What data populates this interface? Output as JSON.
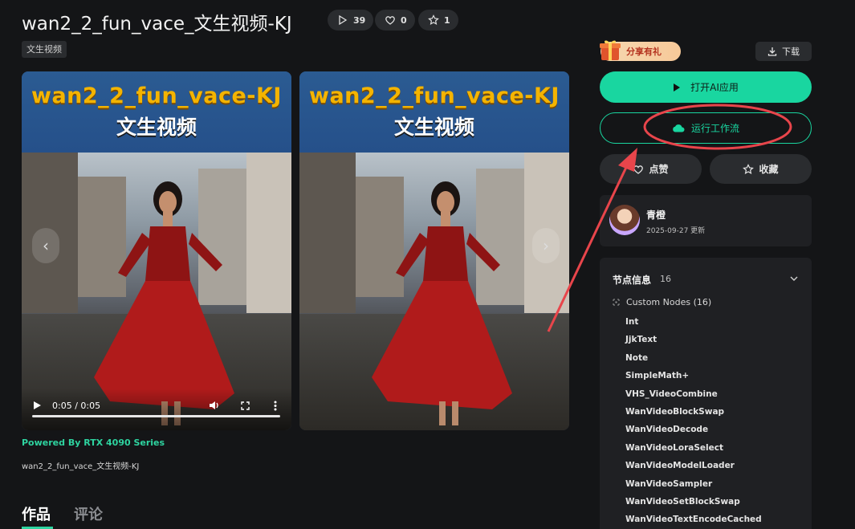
{
  "header": {
    "title": "wan2_2_fun_vace_文生视频-KJ",
    "plays": "39",
    "likes": "0",
    "favorites": "1",
    "tag": "文生视频"
  },
  "media": {
    "banner_title": "wan2_2_fun_vace-KJ",
    "banner_subtitle": "文生视频",
    "time": "0:05 / 0:05",
    "progress_fraction": 1.0,
    "powered_by": "Powered By RTX 4090 Series",
    "filename": "wan2_2_fun_vace_文生视频-KJ"
  },
  "tabs": [
    {
      "label": "作品"
    },
    {
      "label": "评论"
    }
  ],
  "sidebar": {
    "share_label": "分享有礼",
    "download_label": "下载",
    "open_app_label": "打开AI应用",
    "run_workflow_label": "运行工作流",
    "like_label": "点赞",
    "favorite_label": "收藏",
    "author": {
      "name": "青橙",
      "updated": "2025-09-27 更新"
    },
    "nodes": {
      "title": "节点信息",
      "count": "16",
      "custom_label": "Custom Nodes (16)",
      "items": [
        "Int",
        "JjkText",
        "Note",
        "SimpleMath+",
        "VHS_VideoCombine",
        "WanVideoBlockSwap",
        "WanVideoDecode",
        "WanVideoLoraSelect",
        "WanVideoModelLoader",
        "WanVideoSampler",
        "WanVideoSetBlockSwap",
        "WanVideoTextEncodeCached"
      ]
    }
  },
  "colors": {
    "accent": "#19d6a0",
    "annotation": "#e8454b",
    "background": "#141517"
  }
}
